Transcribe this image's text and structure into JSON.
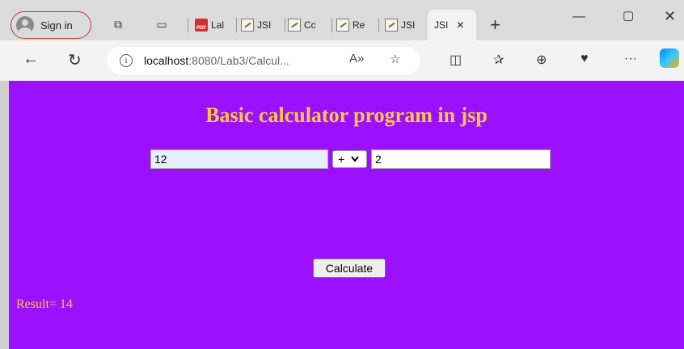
{
  "browser": {
    "sign_in_label": "Sign in",
    "tabs": [
      {
        "label": "Lal",
        "icon": "pdf-icon"
      },
      {
        "label": "JSI",
        "icon": "image-icon"
      },
      {
        "label": "Cc",
        "icon": "image-icon"
      },
      {
        "label": "Re",
        "icon": "image-icon"
      },
      {
        "label": "JSI",
        "icon": "image-icon"
      }
    ],
    "active_tab": {
      "label": "JSI",
      "close": "✕"
    },
    "new_tab": "+",
    "address": {
      "host": "localhost",
      "path": ":8080/Lab3/Calcul..."
    }
  },
  "page": {
    "heading": "Basic calculator program in jsp",
    "operand1": "12",
    "operator": "+",
    "operand2": "2",
    "calculate_label": "Calculate",
    "result_text": "Result= 14",
    "colors": {
      "background": "#9a10ff",
      "accent": "#ffc83d"
    }
  }
}
